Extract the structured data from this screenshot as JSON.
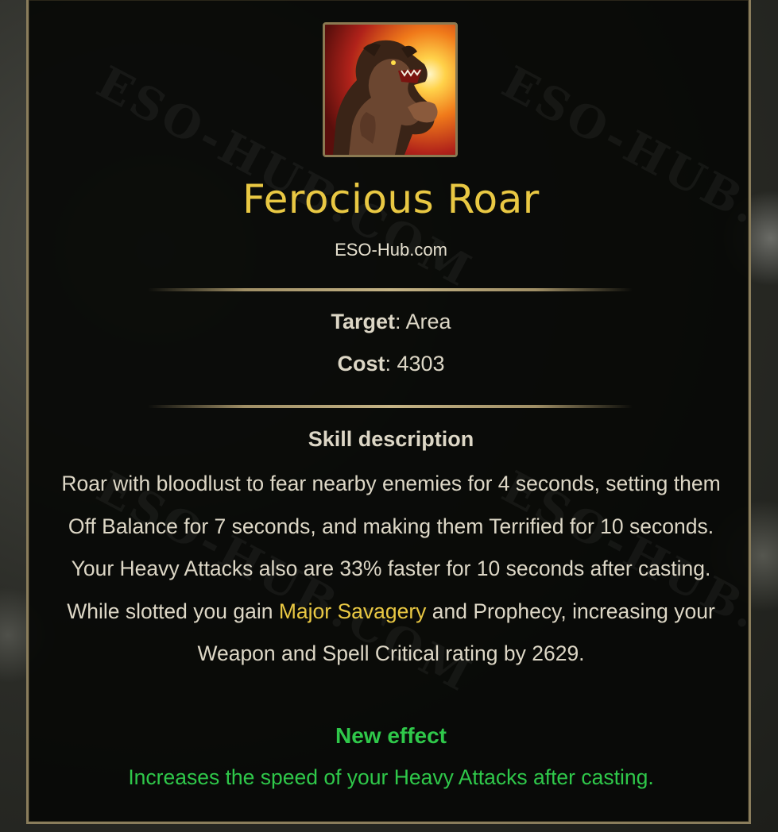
{
  "skill": {
    "name": "Ferocious Roar",
    "source": "ESO-Hub.com",
    "icon": "werewolf-roar-icon"
  },
  "stats": {
    "target_label": "Target",
    "target_value": "Area",
    "cost_label": "Cost",
    "cost_value": "4303"
  },
  "description": {
    "heading": "Skill description",
    "text_before": "Roar with bloodlust to fear nearby enemies for 4 seconds, setting them Off Balance for 7 seconds, and making them Terrified for 10 seconds. Your Heavy Attacks also are 33% faster for 10 seconds after casting. While slotted you gain",
    "highlight": "Major Savagery",
    "text_after": "and Prophecy, increasing your Weapon and Spell Critical rating by 2629."
  },
  "new_effect": {
    "heading": "New effect",
    "text": "Increases the speed of your Heavy Attacks after casting."
  },
  "watermark": "ESO-HUB.COM",
  "colors": {
    "title": "#e9c843",
    "body": "#ddd7c6",
    "new_effect": "#2fc84a",
    "border": "#8a7d5c"
  }
}
